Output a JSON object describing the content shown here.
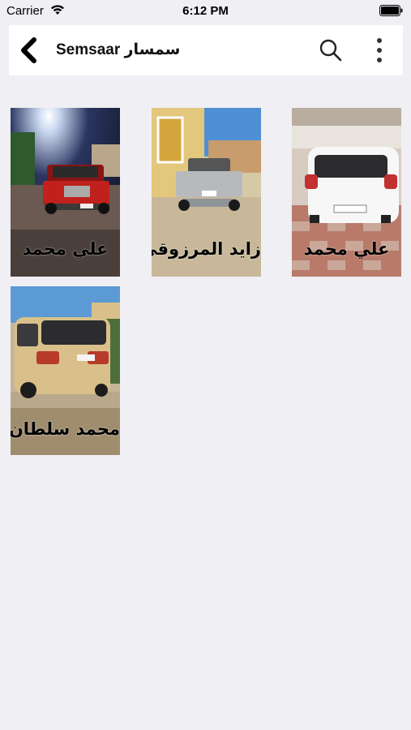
{
  "status_bar": {
    "carrier": "Carrier",
    "time": "6:12 PM",
    "wifi_icon": "wifi-icon",
    "battery_icon": "battery-icon"
  },
  "app_bar": {
    "title": "Semsaar سمسار",
    "back_icon": "back-chevron-icon",
    "search_icon": "search-icon",
    "more_icon": "more-vertical-icon"
  },
  "listings": [
    {
      "owner": "علي محمد",
      "photo": "red-gmc-pickup"
    },
    {
      "owner": "زايد المرزوقي",
      "photo": "silver-ford-pickup"
    },
    {
      "owner": "علي محمد",
      "photo": "white-hatchback"
    },
    {
      "owner": "محمد سلطان",
      "photo": "gold-suv"
    }
  ]
}
